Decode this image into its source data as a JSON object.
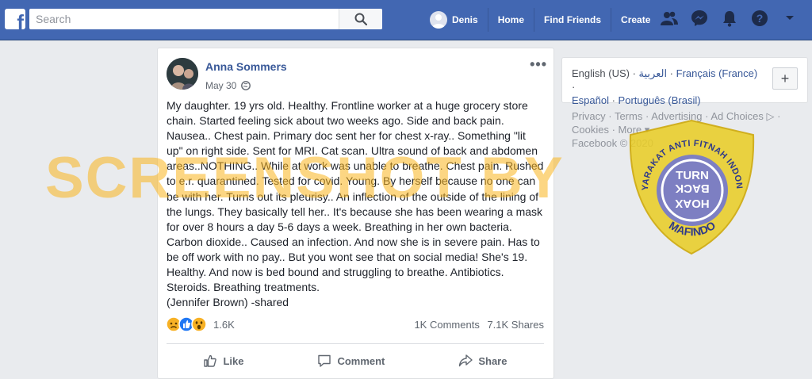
{
  "topbar": {
    "search_placeholder": "Search",
    "user_name": "Denis",
    "nav": [
      "Home",
      "Find Friends",
      "Create"
    ],
    "brand_color": "#4267b2"
  },
  "post": {
    "author": "Anna Sommers",
    "date": "May 30",
    "lines": [
      "My daughter. 19 yrs old. Healthy. Frontline worker at a huge grocery store",
      "chain. Started feeling sick about two weeks ago. Side and back pain.",
      "Nausea.. Chest pain. Primary doc sent her for chest x-ray.. Something \"lit",
      "up\" on right side. Sent for MRI. Cat scan. Ultra sound of back and abdomen",
      "areas..NOTHING.. While at work was unable to breathe. Chest pain. Rushed",
      "to e.r. quarantined. Tested for covid. Young. By herself because no one can",
      "be with her. Turns out its pleurisy.. An inflection of the outside of the lining of",
      "the lungs. They basically tell her.. It's because she has been wearing a mask",
      "for over 8 hours a day 5-6 days a week. Breathing in her own bacteria.",
      "Carbon dioxide.. Caused an infection. And now she is in severe pain. Has to",
      "be off work with no pay.. But you wont see that on social media! She's 19.",
      "Healthy. And now is bed bound and struggling to breathe. Antibiotics.",
      "Steroids. Breathing treatments.",
      "(Jennifer Brown) -shared"
    ],
    "reaction_count": "1.6K",
    "comments": "1K Comments",
    "shares": "7.1K Shares",
    "actions": {
      "like": "Like",
      "comment": "Comment",
      "share": "Share"
    }
  },
  "sidebar": {
    "languages": {
      "current": "English (US)",
      "others": [
        "العربية",
        "Français (France)",
        "Español",
        "Português (Brasil)"
      ]
    },
    "footer_links": [
      "Privacy",
      "Terms",
      "Advertising",
      "Ad Choices",
      "Cookies",
      "More"
    ],
    "copyright": "Facebook © 2020"
  },
  "overlay": {
    "watermark": "SCREENSHOT BY",
    "badge_top": "MASYARAKAT ANTI FITNAH INDONESIA",
    "badge_bottom": "MAFINDO",
    "badge_center": [
      "TURN",
      "BACK",
      "HOAX"
    ]
  }
}
